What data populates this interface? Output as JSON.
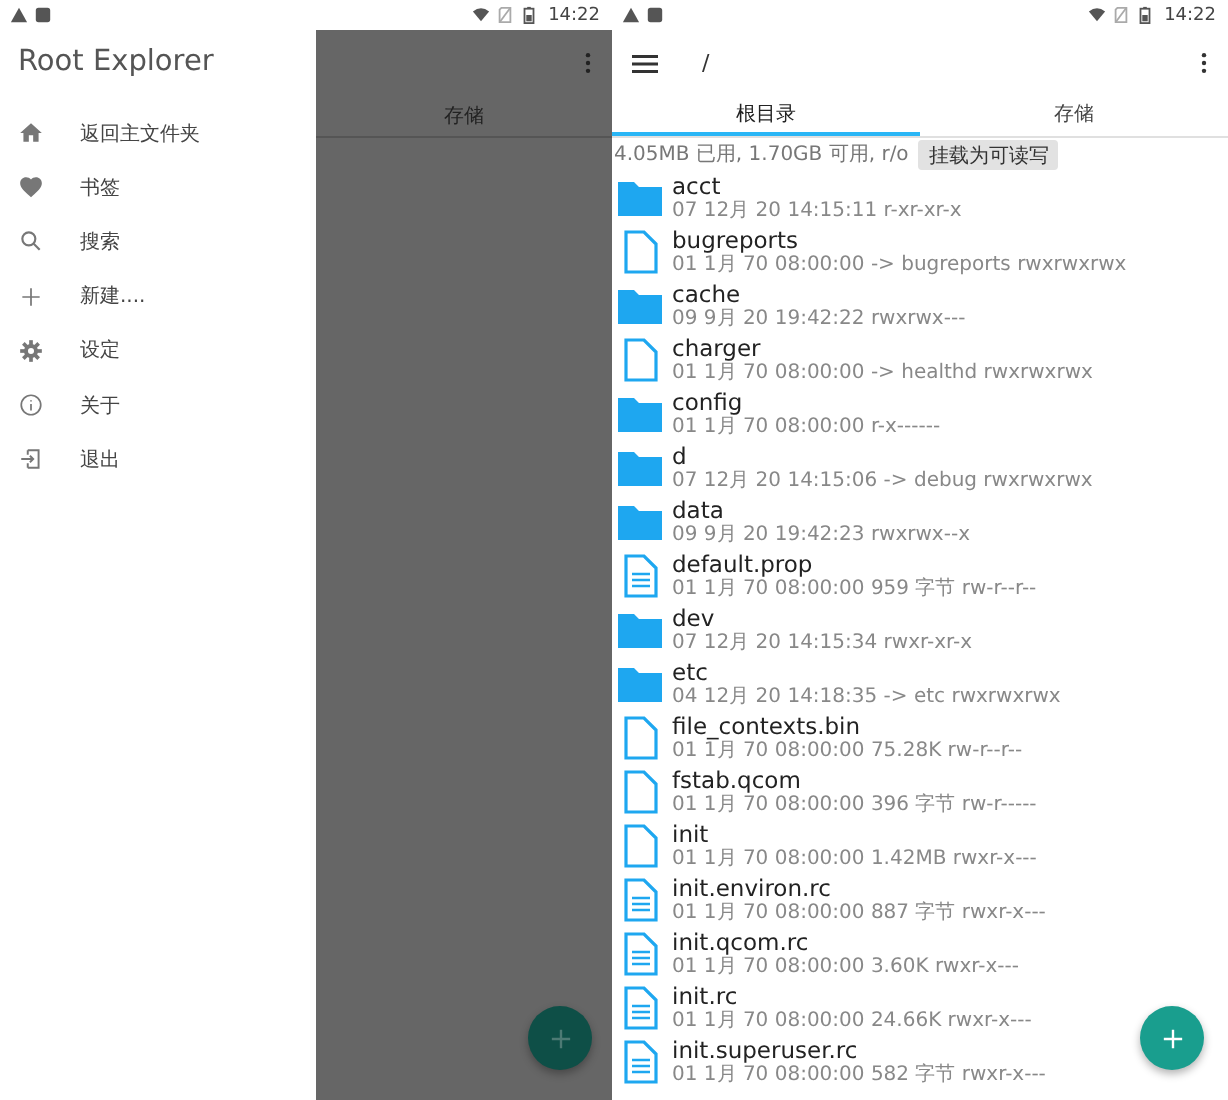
{
  "left_screen": {
    "status_bar": {
      "time": "14:22"
    },
    "drawer": {
      "title": "Root Explorer",
      "items": [
        {
          "label": "返回主文件夹",
          "kind": "home"
        },
        {
          "label": "书签",
          "kind": "heart"
        },
        {
          "label": "搜索",
          "kind": "search"
        },
        {
          "label": "新建....",
          "kind": "plus"
        },
        {
          "label": "设定",
          "kind": "gear"
        },
        {
          "label": "关于",
          "kind": "info"
        },
        {
          "label": "退出",
          "kind": "exit"
        }
      ]
    },
    "background": {
      "tab_label": "存储"
    }
  },
  "right_screen": {
    "status_bar": {
      "time": "14:22"
    },
    "toolbar": {
      "path": "/"
    },
    "tabs": [
      {
        "label": "根目录",
        "selected": true
      },
      {
        "label": "存储",
        "selected": false
      }
    ],
    "storage_info": "4.05MB 已用, 1.70GB 可用, r/o",
    "mount_button": "挂载为可读写",
    "files": [
      {
        "name": "acct",
        "meta": "07 12月 20 14:15:11  r-xr-xr-x",
        "kind": "folder"
      },
      {
        "name": "bugreports",
        "meta": "01 1月 70 08:00:00 -> bugreports rwxrwxrwx",
        "kind": "file"
      },
      {
        "name": "cache",
        "meta": "09 9月 20 19:42:22  rwxrwx---",
        "kind": "folder"
      },
      {
        "name": "charger",
        "meta": "01 1月 70 08:00:00 -> healthd rwxrwxrwx",
        "kind": "file"
      },
      {
        "name": "config",
        "meta": "01 1月 70 08:00:00  r-x------",
        "kind": "folder"
      },
      {
        "name": "d",
        "meta": "07 12月 20 14:15:06 -> debug rwxrwxrwx",
        "kind": "folder"
      },
      {
        "name": "data",
        "meta": "09 9月 20 19:42:23  rwxrwx--x",
        "kind": "folder"
      },
      {
        "name": "default.prop",
        "meta": "01 1月 70 08:00:00 959 字节 rw-r--r--",
        "kind": "text"
      },
      {
        "name": "dev",
        "meta": "07 12月 20 14:15:34  rwxr-xr-x",
        "kind": "folder"
      },
      {
        "name": "etc",
        "meta": "04 12月 20 14:18:35 -> etc rwxrwxrwx",
        "kind": "folder"
      },
      {
        "name": "file_contexts.bin",
        "meta": "01 1月 70 08:00:00 75.28K rw-r--r--",
        "kind": "file"
      },
      {
        "name": "fstab.qcom",
        "meta": "01 1月 70 08:00:00 396 字节 rw-r-----",
        "kind": "file"
      },
      {
        "name": "init",
        "meta": "01 1月 70 08:00:00 1.42MB rwxr-x---",
        "kind": "file"
      },
      {
        "name": "init.environ.rc",
        "meta": "01 1月 70 08:00:00 887 字节 rwxr-x---",
        "kind": "text"
      },
      {
        "name": "init.qcom.rc",
        "meta": "01 1月 70 08:00:00 3.60K rwxr-x---",
        "kind": "text"
      },
      {
        "name": "init.rc",
        "meta": "01 1月 70 08:00:00 24.66K rwxr-x---",
        "kind": "text"
      },
      {
        "name": "init.superuser.rc",
        "meta": "01 1月 70 08:00:00 582 字节 rwxr-x---",
        "kind": "text"
      }
    ]
  }
}
